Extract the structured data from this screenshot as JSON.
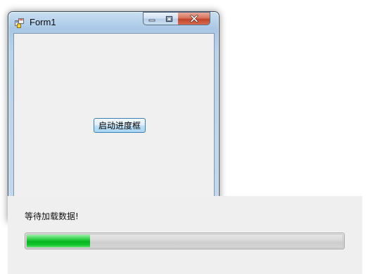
{
  "window": {
    "title": "Form1",
    "controls": {
      "minimize": "minimize-icon",
      "maximize": "maximize-icon",
      "close": "close-icon"
    }
  },
  "form": {
    "start_button_label": "启动进度框"
  },
  "loader": {
    "message": "等待加载数据!",
    "progress_fraction": 0.2,
    "fill_color": "#06b61f"
  },
  "colors": {
    "client_bg": "#f0f0f0",
    "button_border": "#3c7fb1",
    "close_button": "#c1442b"
  }
}
